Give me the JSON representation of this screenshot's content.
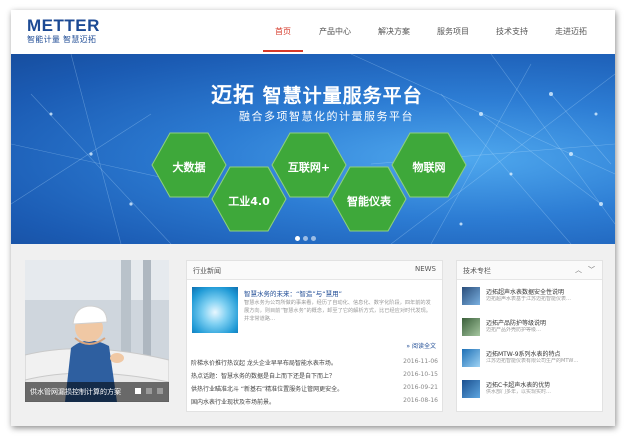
{
  "header": {
    "logo_name": "METTER",
    "logo_slogan": "智能计量  智慧迈拓",
    "nav": [
      {
        "label": "首页",
        "active": true
      },
      {
        "label": "产品中心",
        "active": false
      },
      {
        "label": "解决方案",
        "active": false
      },
      {
        "label": "服务项目",
        "active": false
      },
      {
        "label": "技术支持",
        "active": false
      },
      {
        "label": "走进迈拓",
        "active": false
      }
    ]
  },
  "banner": {
    "title_brand": "迈拓",
    "title_rest": "智慧计量服务平台",
    "subtitle": "融合多项智慧化的计量服务平台",
    "hexagons": [
      "大数据",
      "工业4.0",
      "互联网+",
      "智能仪表",
      "物联网"
    ],
    "slides_total": 3,
    "slide_active": 1
  },
  "photo": {
    "caption": "供水管网漏损控制计算的方案"
  },
  "news": {
    "heading": "行业新闻",
    "heading_en": "NEWS",
    "featured_title": "智慧水务的未来：“智造”与“慧用”",
    "featured_text": "智慧水务为公司所做的事来看，经历了自动化、信息化、数字化阶段，四年前的发展方向，则目前“智慧水务”的概念，卸至了它的解析方式，比已经应对时代发现。并非常道路…",
    "more_label": "» 阅读全文",
    "items": [
      {
        "title": "阶梯水价推行热议起  龙头企业早早布局智能水表市场。",
        "date": "2016-11-06"
      },
      {
        "title": "热点话题：智慧水务的数据是自上而下还是自下而上？",
        "date": "2016-10-15"
      },
      {
        "title": "供热行业瞄准北斗  “新基石”精准位置服务让管网更安全。",
        "date": "2016-09-21"
      },
      {
        "title": "国内水表行业现状及市场前景。",
        "date": "2016-08-16"
      }
    ]
  },
  "tech": {
    "heading": "技术专栏",
    "items": [
      {
        "title": "迈拓超声水表数据安全性说明",
        "desc": "迈拓超声水表基于江苏迈拓智能仪表…"
      },
      {
        "title": "迈拓产品防护等级说明",
        "desc": "迈拓产品外壳防护等级…"
      },
      {
        "title": "迈拓MTW-9系列水表的特点",
        "desc": "江苏迈拓智能仪表有限公司生产的MTW…"
      },
      {
        "title": "迈拓C卡超声水表的优势",
        "desc": "供水部门多年，以实现实时…"
      }
    ]
  },
  "colors": {
    "brand": "#1c4a94",
    "nav_active": "#d63a2a",
    "hexagon": "#3ea83a",
    "banner": "#2d7dd4"
  }
}
